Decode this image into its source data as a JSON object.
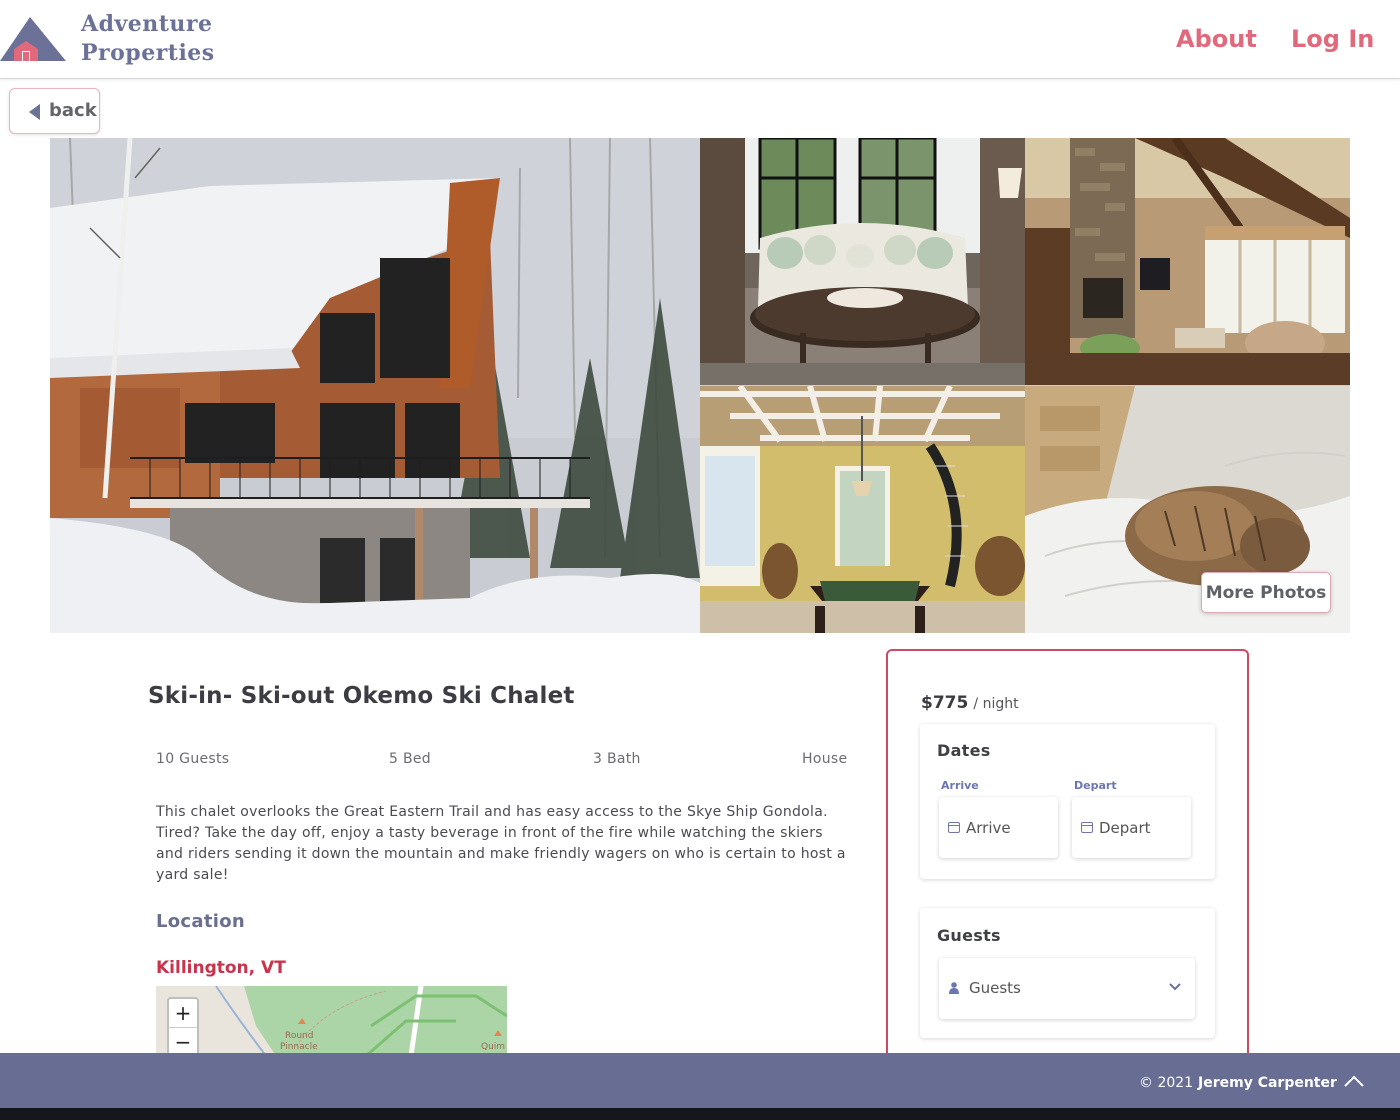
{
  "header": {
    "logo_line1": "Adventure",
    "logo_line2": "Properties",
    "nav": {
      "about": "About",
      "login": "Log In"
    }
  },
  "back_button": {
    "label": "back"
  },
  "gallery": {
    "more_photos_label": "More Photos"
  },
  "listing": {
    "title": "Ski-in- Ski-out Okemo Ski Chalet",
    "stats": {
      "guests": "10 Guests",
      "bed": "5 Bed",
      "bath": "3 Bath",
      "type": "House"
    },
    "description": "This chalet overlooks the Great Eastern Trail and has easy access to the Skye Ship Gondola. Tired? Take the day off, enjoy a tasty beverage in front of the fire while watching the skiers and riders sending it down the mountain and make friendly wagers on who is certain to host a yard sale!",
    "location_heading": "Location",
    "city": "Killington, VT"
  },
  "map": {
    "zoom_in": "+",
    "zoom_out": "−",
    "labels": {
      "round": "Round",
      "pinnacle": "Pinnacle",
      "quim": "Quim"
    }
  },
  "booking": {
    "price": "$775",
    "price_unit": "/ night",
    "dates": {
      "title": "Dates",
      "arrive_label": "Arrive",
      "depart_label": "Depart",
      "arrive_placeholder": "Arrive",
      "depart_placeholder": "Depart"
    },
    "guests": {
      "title": "Guests",
      "placeholder": "Guests"
    }
  },
  "footer": {
    "copyright": "© 2021",
    "name": "Jeremy Carpenter"
  },
  "colors": {
    "brand_slate": "#686d94",
    "accent_pink": "#e06a7c",
    "accent_red": "#c7344b",
    "logo_barn": "#e06a7c"
  },
  "icons": [
    "mountain-barn-logo",
    "caret-left-icon",
    "calendar-icon",
    "person-icon",
    "chevron-down-icon",
    "chevron-up-icon"
  ]
}
